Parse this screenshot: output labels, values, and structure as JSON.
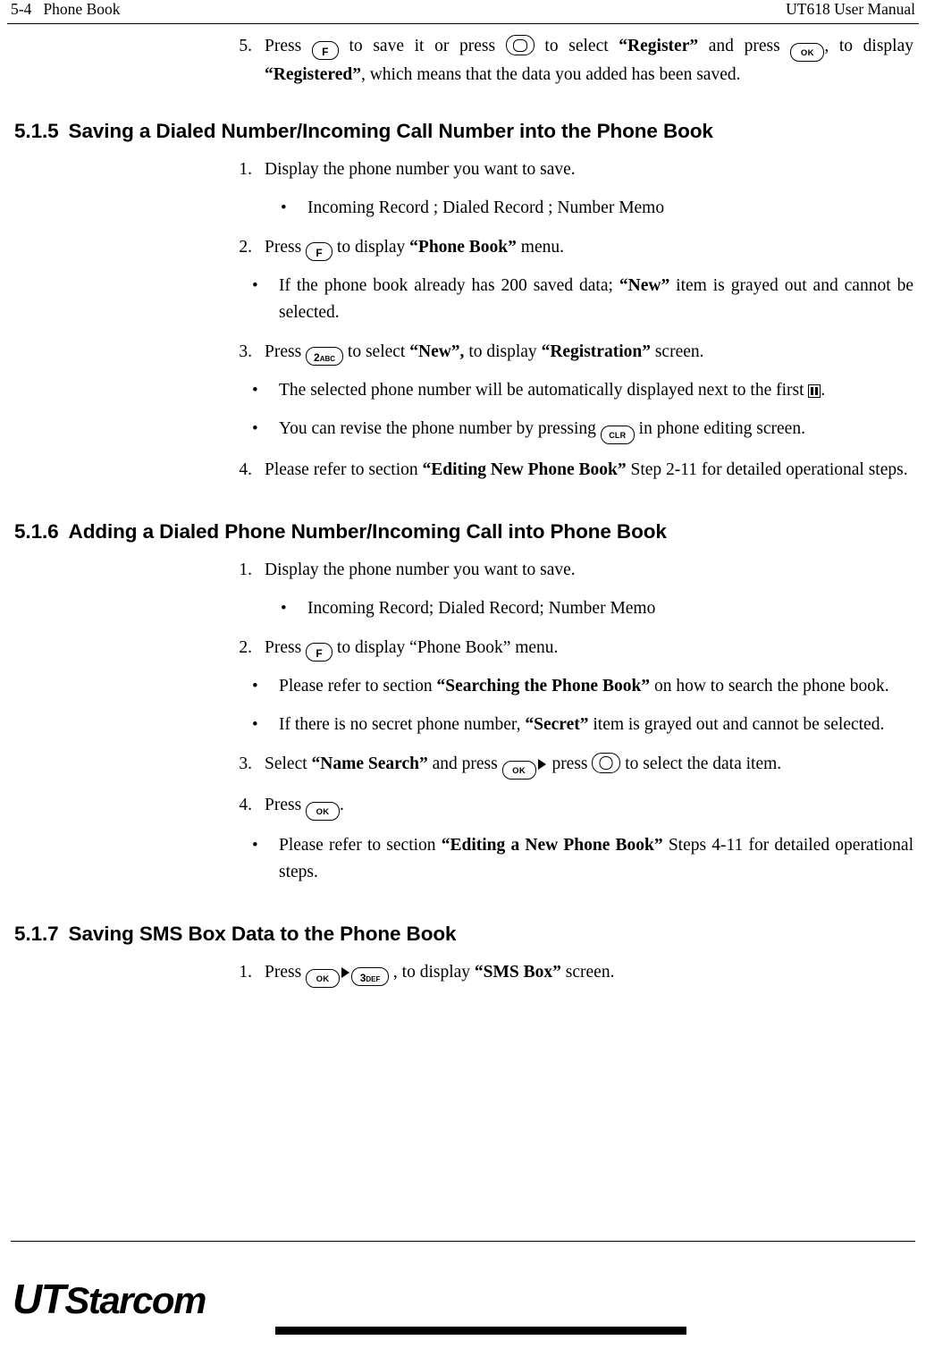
{
  "header": {
    "left": "5-4   Phone Book",
    "right": "UT618 User Manual"
  },
  "intro_item": {
    "num": "5.",
    "text_1": "Press ",
    "text_2": " to save it or press ",
    "text_3": " to select ",
    "bold_register": "“Register”",
    "text_4": " and press ",
    "text_5": ", to display ",
    "bold_registered": "“Registered”",
    "text_6": ", which means that the data you added has been saved."
  },
  "sections": [
    {
      "number": "5.1.5",
      "title": "Saving a Dialed Number/Incoming Call Number into the Phone Book"
    },
    {
      "number": "5.1.6",
      "title": "Adding a Dialed Phone Number/Incoming Call into Phone Book"
    },
    {
      "number": "5.1.7",
      "title": "Saving SMS Box Data to the Phone Book"
    }
  ],
  "s515": {
    "item1_num": "1.",
    "item1_text": "Display the phone number you want to save.",
    "bullet1_text": " Incoming Record ; Dialed Record ; Number Memo",
    "item2_num": "2.",
    "item2_t1": "Press ",
    "item2_t2": " to display ",
    "item2_bold": "“Phone Book”",
    "item2_t3": " menu.",
    "bullet2_t1": "If the phone book already has 200 saved data; ",
    "bullet2_bold": "“New”",
    "bullet2_t2": " item is grayed out and cannot be selected.",
    "item3_num": "3.",
    "item3_t1": "Press ",
    "item3_t2": " to select ",
    "item3_bold1": "“New”,",
    "item3_t3": " to display ",
    "item3_bold2": "“Registration”",
    "item3_t4": " screen.",
    "bullet3_t1": "The selected phone number will be automatically displayed next to the first ",
    "bullet3_t2": ".",
    "bullet4_t1": "You can revise the phone number by pressing ",
    "bullet4_t2": " in phone editing screen.",
    "item4_num": "4.",
    "item4_t1": "Please refer to section ",
    "item4_bold": "“Editing New Phone Book”",
    "item4_t2": " Step 2-11 for detailed operational steps."
  },
  "s516": {
    "item1_num": "1.",
    "item1_text": "Display the phone number you want to save.",
    "bullet1_text": " Incoming Record; Dialed Record; Number Memo",
    "item2_num": "2.",
    "item2_t1": "Press ",
    "item2_t2": " to display “Phone Book” menu.",
    "bullet2_t1": "Please refer to section ",
    "bullet2_bold": "“Searching the Phone Book”",
    "bullet2_t2": " on how to search the phone book.",
    "bullet3_t1": "If there is no secret phone number, ",
    "bullet3_bold": "“Secret”",
    "bullet3_t2": " item is grayed out and cannot be selected.",
    "item3_num": "3.",
    "item3_t1": "Select ",
    "item3_bold": "“Name Search”",
    "item3_t2": " and press ",
    "item3_t3": " press ",
    "item3_t4": " to select the data item.",
    "item4_num": "4.",
    "item4_t1": "Press ",
    "item4_t2": ".",
    "bullet4_t1": "Please refer to section ",
    "bullet4_bold": "“Editing a New Phone Book”",
    "bullet4_t2": " Steps 4-11 for detailed operational steps."
  },
  "s517": {
    "item1_num": "1.",
    "item1_t1": "Press ",
    "item1_t2": " , to display ",
    "item1_bold": "“SMS Box”",
    "item1_t3": " screen."
  },
  "keys": {
    "f": "F",
    "ok": "OK",
    "clr": "CLR",
    "two_digit": "2",
    "two_sub": "ABC",
    "three_digit": "3",
    "three_sub": "DEF"
  },
  "footer": {
    "logo_ut": "UT",
    "logo_starcom": "Starcom"
  }
}
